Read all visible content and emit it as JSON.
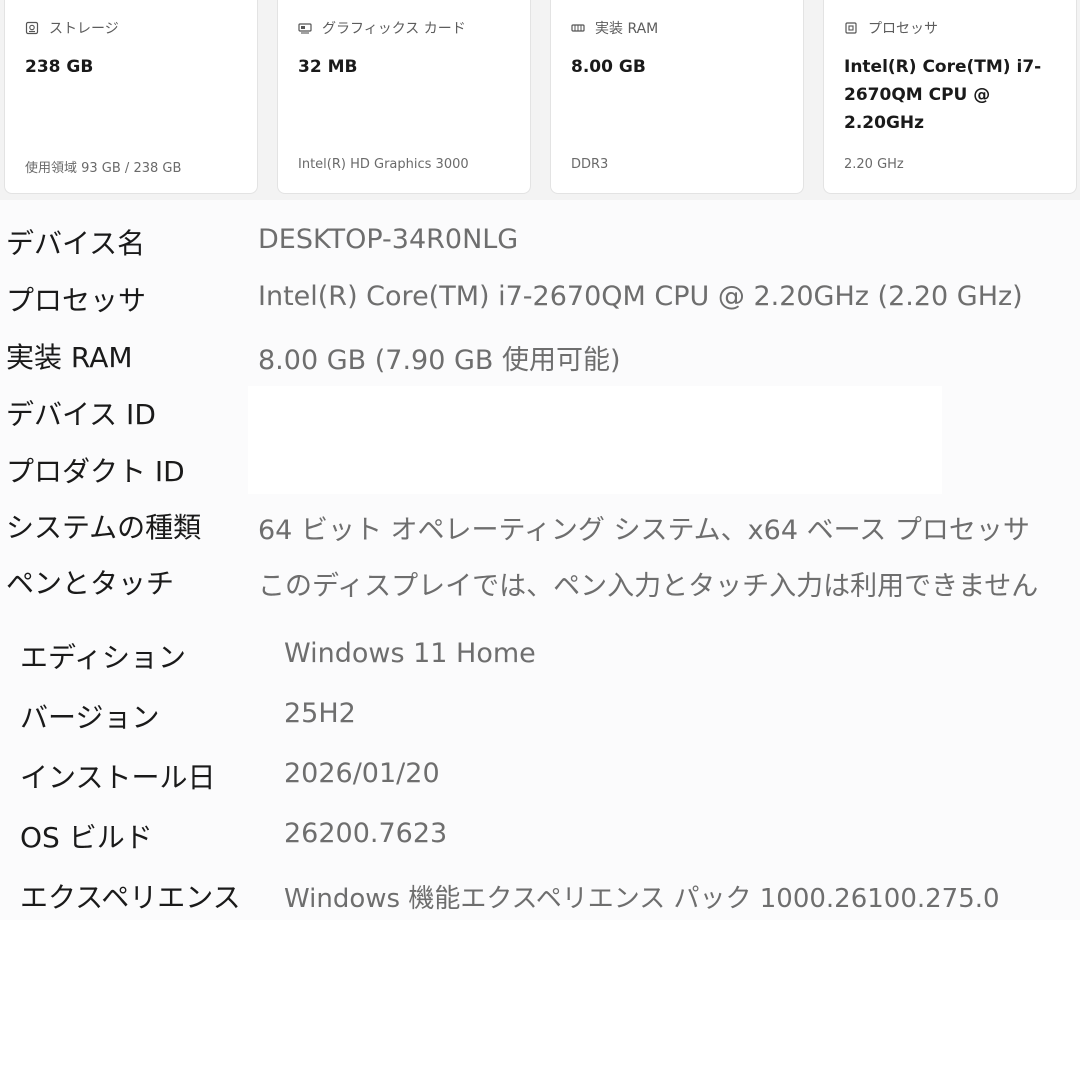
{
  "cards": [
    {
      "title": "ストレージ",
      "icon": "storage-icon",
      "value": "238 GB",
      "sub": "使用領域 93 GB / 238 GB"
    },
    {
      "title": "グラフィックス カード",
      "icon": "graphics-card-icon",
      "value": "32 MB",
      "sub": "Intel(R) HD Graphics 3000"
    },
    {
      "title": "実装 RAM",
      "icon": "ram-icon",
      "value": "8.00 GB",
      "sub": "DDR3"
    },
    {
      "title": "プロセッサ",
      "icon": "processor-icon",
      "value": "Intel(R) Core(TM) i7-2670QM CPU @ 2.20GHz",
      "sub": "2.20 GHz"
    }
  ],
  "device_specs": [
    {
      "label": "デバイス名",
      "value": "DESKTOP-34R0NLG"
    },
    {
      "label": "プロセッサ",
      "value": "Intel(R) Core(TM) i7-2670QM CPU @ 2.20GHz (2.20 GHz)"
    },
    {
      "label": "実装 RAM",
      "value": "8.00 GB (7.90 GB 使用可能)"
    },
    {
      "label": "デバイス ID",
      "value": ""
    },
    {
      "label": "プロダクト ID",
      "value": ""
    },
    {
      "label": "システムの種類",
      "value": "64 ビット オペレーティング システム、x64 ベース プロセッサ"
    },
    {
      "label": "ペンとタッチ",
      "value": "このディスプレイでは、ペン入力とタッチ入力は利用できません"
    }
  ],
  "windows_specs": [
    {
      "label": "エディション",
      "value": "Windows 11 Home"
    },
    {
      "label": "バージョン",
      "value": "25H2"
    },
    {
      "label": "インストール日",
      "value": "2026/01/20"
    },
    {
      "label": "OS ビルド",
      "value": "26200.7623"
    },
    {
      "label": "エクスペリエンス",
      "value": "Windows 機能エクスペリエンス パック 1000.26100.275.0"
    }
  ]
}
